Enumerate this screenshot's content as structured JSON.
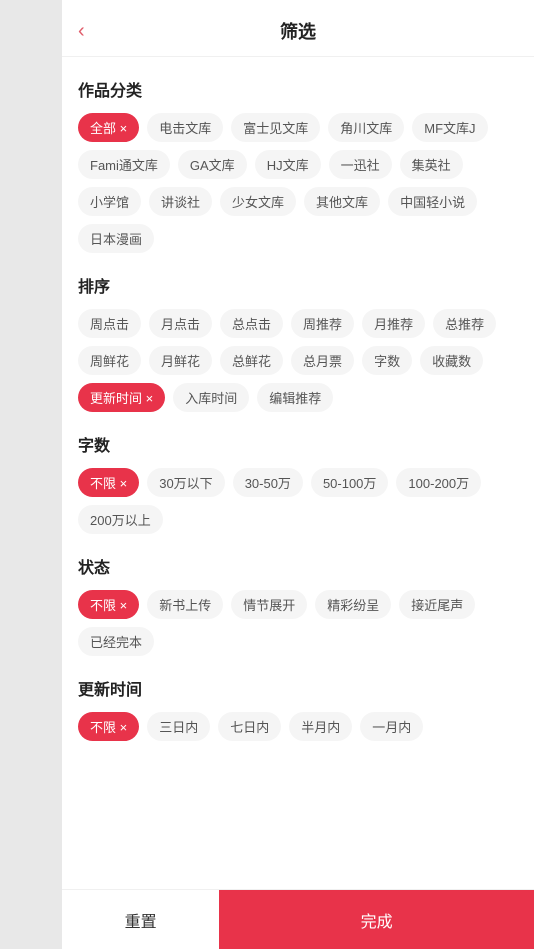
{
  "header": {
    "title": "筛选",
    "back_icon": "‹"
  },
  "sections": {
    "category": {
      "title": "作品分类",
      "tags": [
        {
          "label": "全部",
          "active": true
        },
        {
          "label": "电击文库",
          "active": false
        },
        {
          "label": "富士见文库",
          "active": false
        },
        {
          "label": "角川文库",
          "active": false
        },
        {
          "label": "MF文库J",
          "active": false
        },
        {
          "label": "Fami通文库",
          "active": false
        },
        {
          "label": "GA文库",
          "active": false
        },
        {
          "label": "HJ文库",
          "active": false
        },
        {
          "label": "一迅社",
          "active": false
        },
        {
          "label": "集英社",
          "active": false
        },
        {
          "label": "小学馆",
          "active": false
        },
        {
          "label": "讲谈社",
          "active": false
        },
        {
          "label": "少女文库",
          "active": false
        },
        {
          "label": "其他文库",
          "active": false
        },
        {
          "label": "中国轻小说",
          "active": false
        },
        {
          "label": "日本漫画",
          "active": false
        }
      ]
    },
    "sort": {
      "title": "排序",
      "tags": [
        {
          "label": "周点击",
          "active": false
        },
        {
          "label": "月点击",
          "active": false
        },
        {
          "label": "总点击",
          "active": false
        },
        {
          "label": "周推荐",
          "active": false
        },
        {
          "label": "月推荐",
          "active": false
        },
        {
          "label": "总推荐",
          "active": false
        },
        {
          "label": "周鲜花",
          "active": false
        },
        {
          "label": "月鲜花",
          "active": false
        },
        {
          "label": "总鲜花",
          "active": false
        },
        {
          "label": "总月票",
          "active": false
        },
        {
          "label": "字数",
          "active": false
        },
        {
          "label": "收藏数",
          "active": false
        },
        {
          "label": "更新时间",
          "active": true
        },
        {
          "label": "入库时间",
          "active": false
        },
        {
          "label": "编辑推荐",
          "active": false
        }
      ]
    },
    "words": {
      "title": "字数",
      "tags": [
        {
          "label": "不限",
          "active": true
        },
        {
          "label": "30万以下",
          "active": false
        },
        {
          "label": "30-50万",
          "active": false
        },
        {
          "label": "50-100万",
          "active": false
        },
        {
          "label": "100-200万",
          "active": false
        },
        {
          "label": "200万以上",
          "active": false
        }
      ]
    },
    "status": {
      "title": "状态",
      "tags": [
        {
          "label": "不限",
          "active": true
        },
        {
          "label": "新书上传",
          "active": false
        },
        {
          "label": "情节展开",
          "active": false
        },
        {
          "label": "精彩纷呈",
          "active": false
        },
        {
          "label": "接近尾声",
          "active": false
        },
        {
          "label": "已经完本",
          "active": false
        }
      ]
    },
    "update_time": {
      "title": "更新时间",
      "tags": [
        {
          "label": "不限",
          "active": true
        },
        {
          "label": "三日内",
          "active": false
        },
        {
          "label": "七日内",
          "active": false
        },
        {
          "label": "半月内",
          "active": false
        },
        {
          "label": "一月内",
          "active": false
        }
      ]
    }
  },
  "footer": {
    "reset_label": "重置",
    "confirm_label": "完成"
  }
}
